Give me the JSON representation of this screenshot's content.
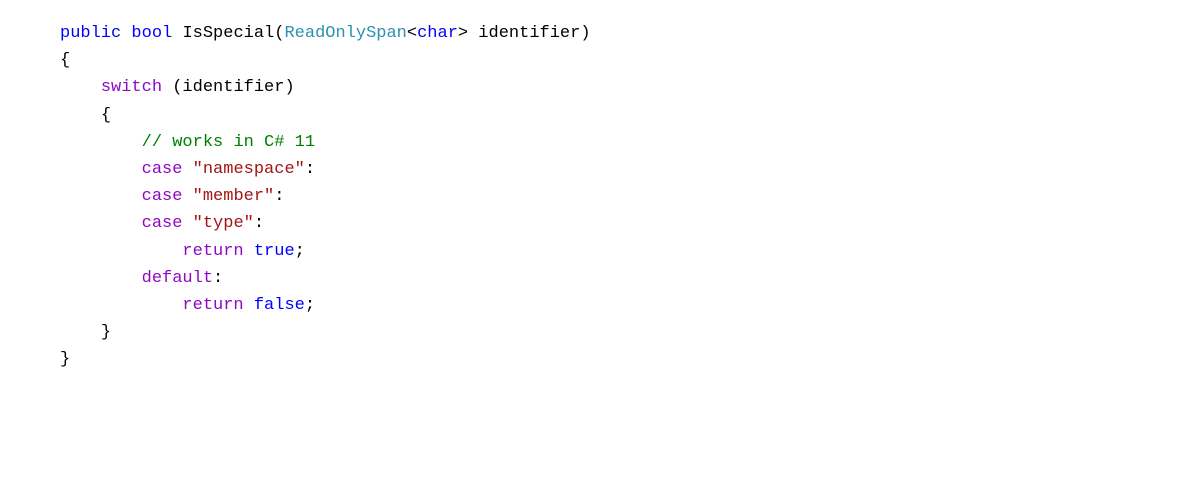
{
  "code": {
    "l1": {
      "public": "public",
      "bool": "bool",
      "method": "IsSpecial",
      "p1": "(",
      "type": "ReadOnlySpan",
      "lt": "<",
      "char": "char",
      "gt": ">",
      "param": " identifier",
      "p2": ")"
    },
    "l2": {
      "brace": "{"
    },
    "l3": {
      "switch": "switch",
      "expr": " (identifier)"
    },
    "l4": {
      "brace": "{"
    },
    "l5": {
      "comment": "// works in C# 11"
    },
    "l6": {
      "case": "case",
      "str": "\"namespace\"",
      "colon": ":"
    },
    "l7": {
      "case": "case",
      "str": "\"member\"",
      "colon": ":"
    },
    "l8": {
      "case": "case",
      "str": "\"type\"",
      "colon": ":"
    },
    "l9": {
      "return": "return",
      "val": "true",
      "semi": ";"
    },
    "l10": {
      "default": "default",
      "colon": ":"
    },
    "l11": {
      "return": "return",
      "val": "false",
      "semi": ";"
    },
    "l12": {
      "brace": "}"
    },
    "l13": {
      "brace": "}"
    }
  }
}
